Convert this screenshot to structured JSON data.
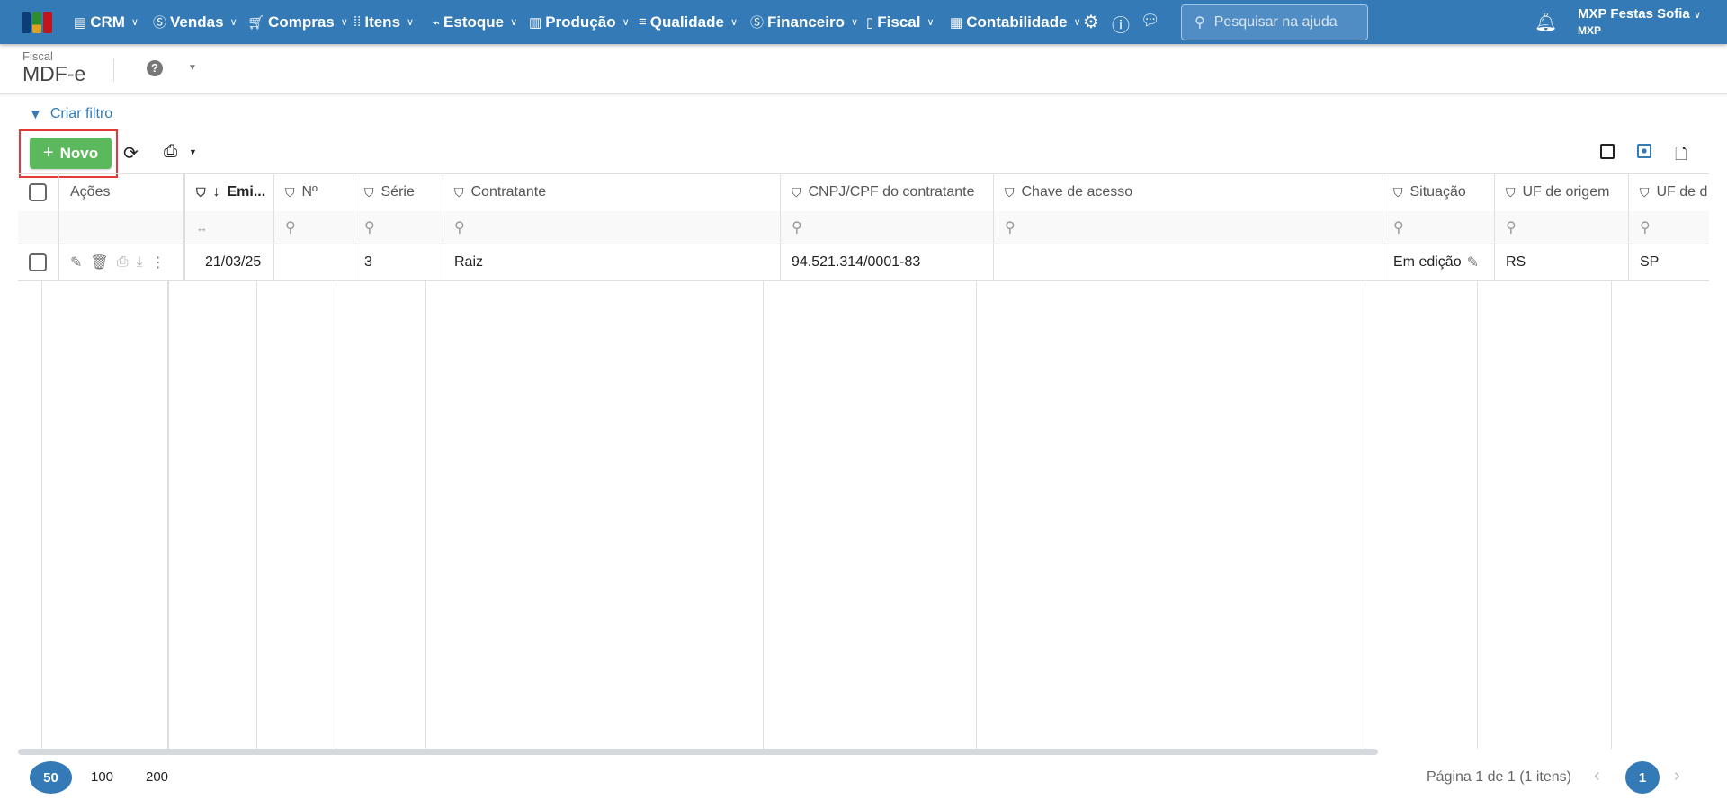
{
  "topbar": {
    "menu": [
      {
        "label": "CRM",
        "icon": "crm-icon"
      },
      {
        "label": "Vendas",
        "icon": "dollar-icon"
      },
      {
        "label": "Compras",
        "icon": "cart-icon"
      },
      {
        "label": "Itens",
        "icon": "items-icon"
      },
      {
        "label": "Estoque",
        "icon": "stock-icon"
      },
      {
        "label": "Produção",
        "icon": "factory-icon"
      },
      {
        "label": "Qualidade",
        "icon": "checklist-icon"
      },
      {
        "label": "Financeiro",
        "icon": "money-bag-icon"
      },
      {
        "label": "Fiscal",
        "icon": "document-icon"
      },
      {
        "label": "Contabilidade",
        "icon": "calculator-icon"
      }
    ],
    "search_placeholder": "Pesquisar na ajuda",
    "user_name": "MXP Festas Sofia",
    "company": "MXP"
  },
  "page": {
    "breadcrumb": "Fiscal",
    "title": "MDF-e"
  },
  "toolbar": {
    "create_filter": "Criar filtro",
    "new_label": "Novo"
  },
  "table": {
    "columns": [
      "Ações",
      "Emi...",
      "Nº",
      "Série",
      "Contratante",
      "CNPJ/CPF do contratante",
      "Chave de acesso",
      "Situação",
      "UF de origem",
      "UF de d"
    ],
    "rows": [
      {
        "emissao": "21/03/25",
        "numero": "",
        "serie": "3",
        "contratante": "Raiz",
        "cnpj": "94.521.314/0001-83",
        "chave": "",
        "situacao": "Em edição",
        "uf_origem": "RS",
        "uf_destino": "SP"
      }
    ]
  },
  "footer": {
    "page_sizes": [
      "50",
      "100",
      "200"
    ],
    "selected_size": "50",
    "page_info": "Página 1 de 1 (1 itens)",
    "current_page": "1"
  },
  "colors": {
    "primary": "#337ab7",
    "success": "#5cb85c",
    "highlight": "#e53935"
  }
}
